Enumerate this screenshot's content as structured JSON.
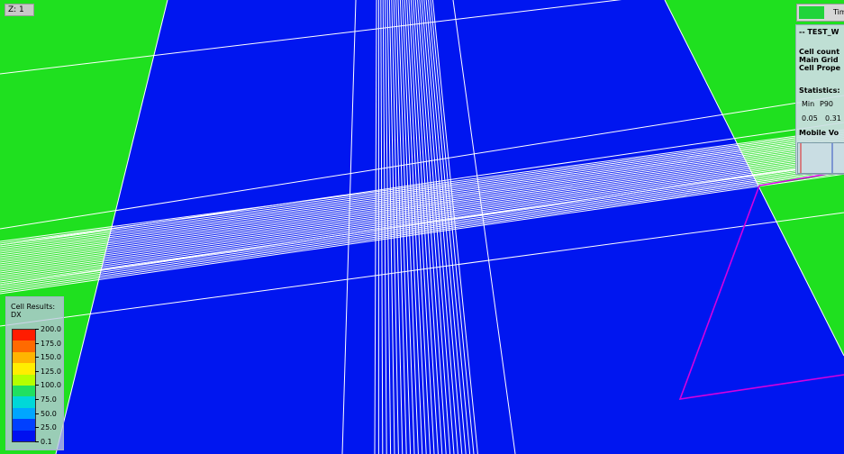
{
  "viewport": {
    "z_label": "Z: 1",
    "colors": {
      "background": "#0016f0",
      "inactive_cells": "#1fe01f",
      "grid_lines": "#ffffff",
      "well_path": "#d400e0"
    }
  },
  "legend": {
    "title_line1": "Cell Results:",
    "title_line2": "DX",
    "labels": [
      "200.0",
      "175.0",
      "150.0",
      "125.0",
      "100.0",
      "75.0",
      "50.0",
      "25.0",
      "0.1"
    ],
    "colors": [
      "#ff1c00",
      "#ff6a00",
      "#ffb400",
      "#ffee00",
      "#b5ff00",
      "#20e060",
      "#00d8d8",
      "#00a6ff",
      "#0040ff",
      "#0010f0"
    ]
  },
  "info_box": {
    "title": "-- TEST_W",
    "cell_count": "Cell count",
    "main_grid": "Main Grid",
    "cell_property": "Cell Prope",
    "statistics": "Statistics:",
    "stat_headers": [
      "Min",
      "P90"
    ],
    "stat_values": [
      "0.05",
      "0.31"
    ],
    "mobile_volume": "Mobile Vo"
  },
  "time_box": {
    "label": "Tim",
    "swatch_color": "#21d43a"
  }
}
